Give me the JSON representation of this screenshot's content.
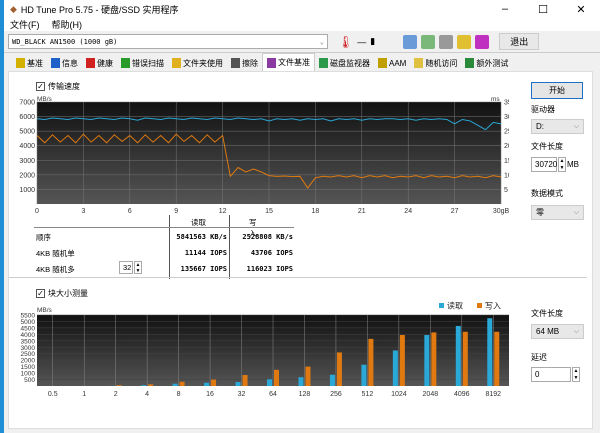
{
  "window": {
    "title": "HD Tune Pro 5.75 - 硬盘/SSD 实用程序",
    "minimize": "–",
    "maximize": "☐",
    "close": "✕"
  },
  "menu": [
    "文件(F)",
    "帮助(H)"
  ],
  "toolbar": {
    "drive": "WD_BLACK AN1500 (1000 gB)",
    "temp": "—",
    "exit": "退出"
  },
  "tabs": [
    {
      "label": "基准",
      "icon": "benchmark-icon",
      "color": "#d4b000"
    },
    {
      "label": "信息",
      "icon": "info-icon",
      "color": "#1e5fc8"
    },
    {
      "label": "健康",
      "icon": "health-cross-icon",
      "color": "#d02020"
    },
    {
      "label": "错误扫描",
      "icon": "magnifier-icon",
      "color": "#2a9a2a"
    },
    {
      "label": "文件夹使用",
      "icon": "folder-icon",
      "color": "#e0b020"
    },
    {
      "label": "擦除",
      "icon": "trash-icon",
      "color": "#555555"
    },
    {
      "label": "文件基准",
      "icon": "file-benchmark-icon",
      "color": "#8a3aa0",
      "active": true
    },
    {
      "label": "磁盘监视器",
      "icon": "monitor-icon",
      "color": "#2a9a4a"
    },
    {
      "label": "AAM",
      "icon": "speaker-icon",
      "color": "#c0a000"
    },
    {
      "label": "随机访问",
      "icon": "random-access-icon",
      "color": "#e0c040"
    },
    {
      "label": "额外测试",
      "icon": "extra-tests-icon",
      "color": "#2a8a3a"
    }
  ],
  "transfer": {
    "checkbox_label": "传输速度",
    "checked": true
  },
  "blocksize": {
    "checkbox_label": "块大小测量",
    "checked": true
  },
  "results": {
    "header_read": "读取",
    "header_write": "写入",
    "rows": [
      {
        "label": "顺序",
        "read": "5841563 KB/s",
        "write": "2528808 KB/s"
      },
      {
        "label": "4KB 随机单",
        "read": "11144 IOPS",
        "write": "43706 IOPS"
      },
      {
        "label": "4KB 随机多",
        "read": "135667 IOPS",
        "write": "116023 IOPS"
      }
    ],
    "queue_depth": "32"
  },
  "right_panel": {
    "start": "开始",
    "drive_label": "驱动器",
    "drive_value": "D:",
    "file_length_label": "文件长度",
    "file_length_value": "30720",
    "file_length_unit": "MB",
    "pattern_label": "数据模式",
    "pattern_value": "零",
    "block_file_length_label": "文件长度",
    "block_file_length_value": "64 MB",
    "delay_label": "延迟",
    "delay_value": "0"
  },
  "colors": {
    "read": "#2aa8d8",
    "write": "#e07a10",
    "plot_bg": "#1a1a1a"
  },
  "chart_data": [
    {
      "type": "line",
      "ylabel_left": "MB/s",
      "ylabel_right": "ms",
      "xlim": [
        0,
        30
      ],
      "ylim": [
        0,
        7000
      ],
      "y2lim": [
        0,
        35
      ],
      "x_ticks": [
        "0",
        "3",
        "6",
        "9",
        "12",
        "15",
        "18",
        "21",
        "24",
        "27",
        "30gB"
      ],
      "y_ticks": [
        1000,
        2000,
        3000,
        4000,
        5000,
        6000,
        7000
      ],
      "y2_ticks": [
        5,
        10,
        15,
        20,
        25,
        30,
        35
      ],
      "grid": true,
      "x_step": 0.5,
      "series": [
        {
          "key": "read",
          "values": [
            5850,
            5800,
            5900,
            5850,
            5800,
            5900,
            5850,
            5800,
            5900,
            5850,
            5800,
            5900,
            5850,
            5750,
            5900,
            5850,
            5800,
            5900,
            5850,
            5800,
            5900,
            5850,
            5800,
            5900,
            5850,
            5800,
            5900,
            5850,
            5800,
            5850,
            5700,
            5850,
            5800,
            5850,
            5750,
            5850,
            5800,
            5850,
            5700,
            5850,
            5800,
            5850,
            5750,
            5850,
            5800,
            5850,
            5850,
            5800,
            5850,
            5750,
            5850,
            5800,
            5850,
            5800,
            5500,
            5800,
            5700,
            5400,
            5100,
            5600,
            5500
          ]
        },
        {
          "key": "write",
          "values": [
            4700,
            4200,
            4750,
            4250,
            4700,
            4200,
            4800,
            4250,
            4700,
            4200,
            4750,
            4300,
            4700,
            4200,
            4750,
            4250,
            4700,
            4200,
            4800,
            4300,
            4700,
            4200,
            4750,
            4250,
            4700,
            1900,
            2500,
            2200,
            2400,
            2200,
            1950,
            1900,
            1920,
            1880,
            1900,
            1100,
            1800,
            1900,
            1850,
            1950,
            1850,
            1950,
            1800,
            1950,
            1850,
            1950,
            1800,
            1900,
            1850,
            1950,
            1800,
            1950,
            1850,
            1900,
            1800,
            1950,
            1850,
            1900,
            1800,
            1950,
            1850
          ]
        }
      ]
    },
    {
      "type": "bar",
      "ylabel": "MB/s",
      "ylim": [
        0,
        5500
      ],
      "y_ticks": [
        500,
        1000,
        1500,
        2000,
        2500,
        3000,
        3500,
        4000,
        4500,
        5000,
        5500
      ],
      "categories": [
        "0.5",
        "1",
        "2",
        "4",
        "8",
        "16",
        "32",
        "64",
        "128",
        "256",
        "512",
        "1024",
        "2048",
        "4096",
        "8192"
      ],
      "legend": "top-right",
      "series": [
        {
          "name": "读取",
          "key": "read",
          "values": [
            0,
            0,
            10,
            60,
            180,
            250,
            310,
            520,
            680,
            870,
            1650,
            2750,
            3950,
            4650,
            5250
          ]
        },
        {
          "name": "写入",
          "key": "write",
          "values": [
            0,
            0,
            60,
            130,
            330,
            500,
            850,
            1250,
            1500,
            2600,
            3650,
            3950,
            4150,
            4200,
            4200
          ]
        }
      ]
    }
  ]
}
